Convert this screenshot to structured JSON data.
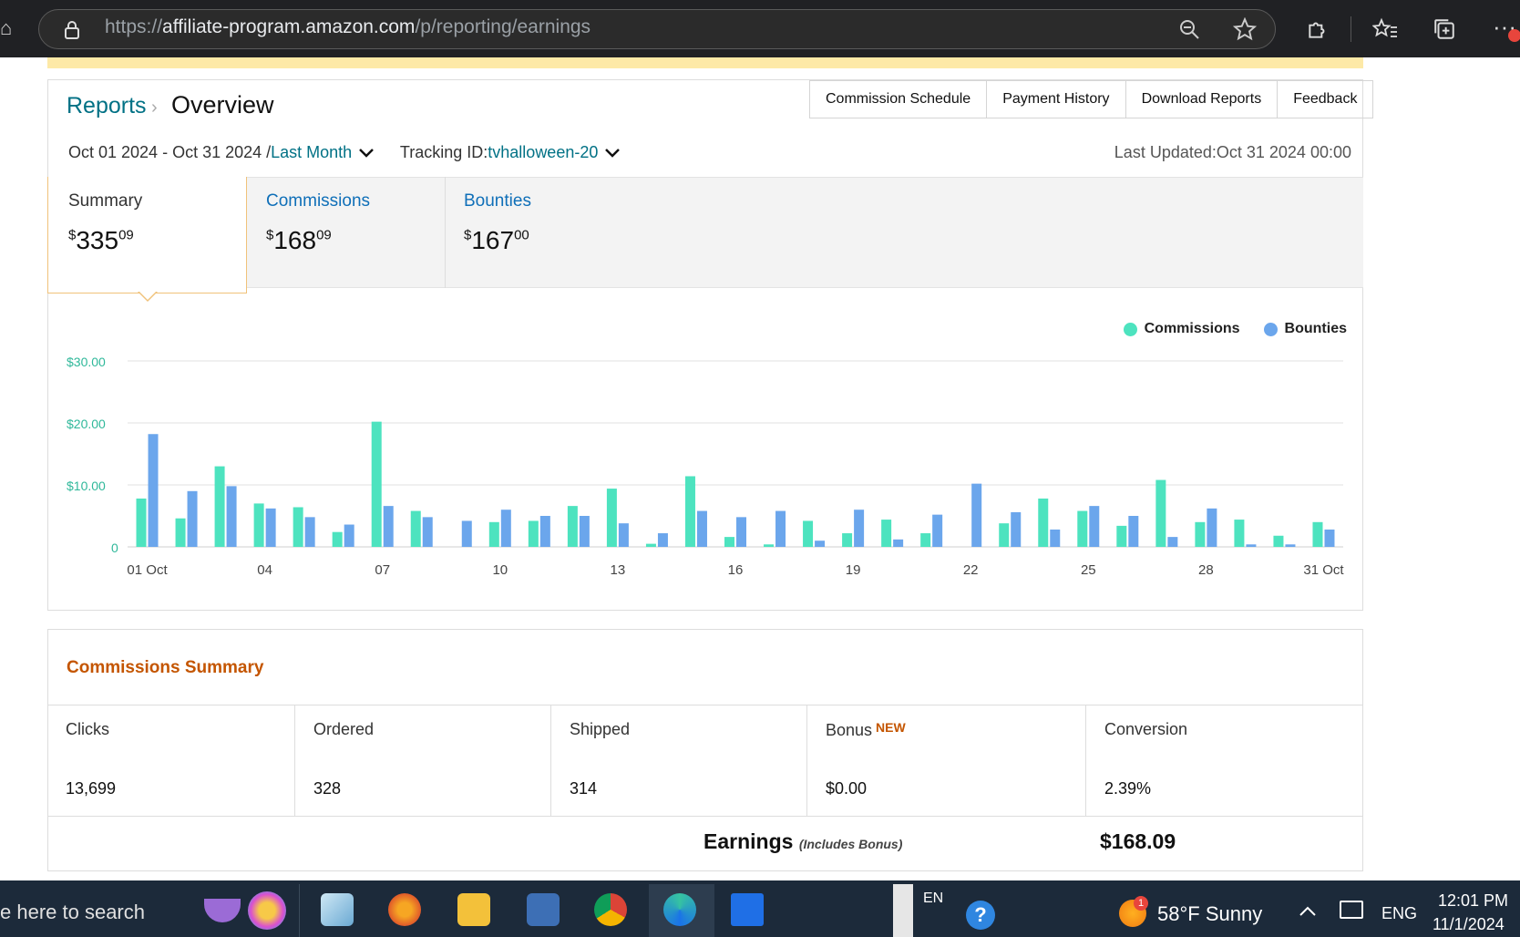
{
  "browser": {
    "url_scheme": "https://",
    "url_host": "affiliate-program.amazon.com",
    "url_path": "/p/reporting/earnings"
  },
  "breadcrumb": {
    "parent": "Reports",
    "separator": "›",
    "current": "Overview"
  },
  "top_nav": [
    "Commission Schedule",
    "Payment History",
    "Download Reports",
    "Feedback"
  ],
  "filters": {
    "date_range": "Oct 01 2024 - Oct 31 2024 /",
    "period": "Last Month",
    "tracking_label": "Tracking ID:",
    "tracking_id": "tvhalloween-20",
    "last_updated": "Last Updated:Oct 31 2024 00:00"
  },
  "tabs": {
    "summary": {
      "label": "Summary",
      "currency": "$",
      "whole": "335",
      "cents": "09"
    },
    "commissions": {
      "label": "Commissions",
      "currency": "$",
      "whole": "168",
      "cents": "09"
    },
    "bounties": {
      "label": "Bounties",
      "currency": "$",
      "whole": "167",
      "cents": "00"
    }
  },
  "colors": {
    "commissions": "#4de3bf",
    "bounties": "#6ba6ec",
    "link": "#007185",
    "accent": "#c45500"
  },
  "chart_data": {
    "type": "bar",
    "x": [
      1,
      2,
      3,
      4,
      5,
      6,
      7,
      8,
      9,
      10,
      11,
      12,
      13,
      14,
      15,
      16,
      17,
      18,
      19,
      20,
      21,
      22,
      23,
      24,
      25,
      26,
      27,
      28,
      29,
      30,
      31
    ],
    "x_ticks": [
      {
        "x": 1,
        "label": "01 Oct"
      },
      {
        "x": 4,
        "label": "04"
      },
      {
        "x": 7,
        "label": "07"
      },
      {
        "x": 10,
        "label": "10"
      },
      {
        "x": 13,
        "label": "13"
      },
      {
        "x": 16,
        "label": "16"
      },
      {
        "x": 19,
        "label": "19"
      },
      {
        "x": 22,
        "label": "22"
      },
      {
        "x": 25,
        "label": "25"
      },
      {
        "x": 28,
        "label": "28"
      },
      {
        "x": 31,
        "label": "31 Oct"
      }
    ],
    "y_ticks": [
      {
        "value": 0,
        "label": "0"
      },
      {
        "value": 10,
        "label": "$10.00"
      },
      {
        "value": 20,
        "label": "$20.00"
      },
      {
        "value": 30,
        "label": "$30.00"
      }
    ],
    "ylim": [
      0,
      30
    ],
    "grid": true,
    "legend": "top-right",
    "series": [
      {
        "name": "Commissions",
        "color": "#4de3bf",
        "values": [
          7.8,
          4.6,
          13.0,
          7.0,
          6.4,
          2.4,
          20.2,
          5.8,
          0,
          4.0,
          4.2,
          6.6,
          9.4,
          0.5,
          11.4,
          1.6,
          0.4,
          4.2,
          2.2,
          4.4,
          2.2,
          0,
          3.8,
          7.8,
          5.8,
          3.4,
          10.8,
          4.0,
          4.4,
          1.8,
          4.0
        ]
      },
      {
        "name": "Bounties",
        "color": "#6ba6ec",
        "values": [
          18.2,
          9.0,
          9.8,
          6.2,
          4.8,
          3.6,
          6.6,
          4.8,
          4.2,
          6.0,
          5.0,
          5.0,
          3.8,
          2.2,
          5.8,
          4.8,
          5.8,
          1.0,
          6.0,
          1.2,
          5.2,
          10.2,
          5.6,
          2.8,
          6.6,
          5.0,
          1.6,
          6.2,
          0.4,
          0.4,
          2.8
        ]
      }
    ]
  },
  "commissions_summary": {
    "title": "Commissions Summary",
    "stats": [
      {
        "label": "Clicks",
        "value": "13,699"
      },
      {
        "label": "Ordered",
        "value": "328"
      },
      {
        "label": "Shipped",
        "value": "314"
      },
      {
        "label": "Bonus",
        "badge": "NEW",
        "value": "$0.00"
      },
      {
        "label": "Conversion",
        "value": "2.39%"
      }
    ],
    "earnings_label": "Earnings",
    "earnings_sub": "(Includes Bonus)",
    "earnings_value": "$168.09"
  },
  "taskbar": {
    "search_text": "e here to search",
    "input_lang": "EN",
    "weather": "58°F  Sunny",
    "weather_badge": "1",
    "lang": "ENG",
    "time": "12:01 PM",
    "date": "11/1/2024"
  }
}
